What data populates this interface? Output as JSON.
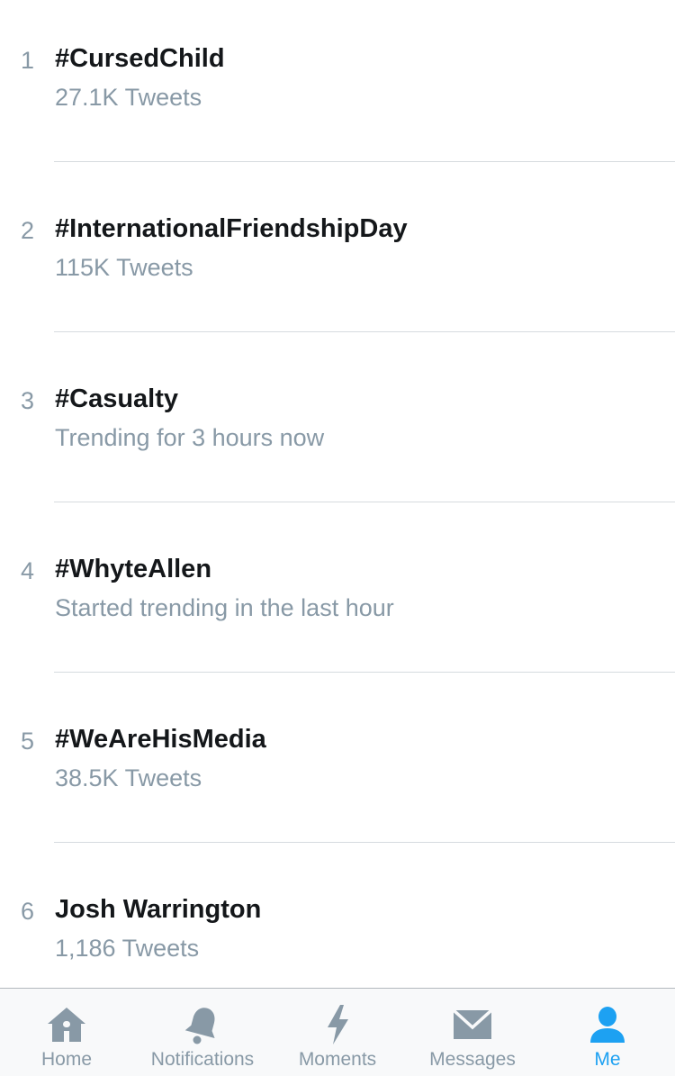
{
  "trends": [
    {
      "rank": "1",
      "name": "#CursedChild",
      "meta": "27.1K Tweets"
    },
    {
      "rank": "2",
      "name": "#InternationalFriendshipDay",
      "meta": "115K Tweets"
    },
    {
      "rank": "3",
      "name": "#Casualty",
      "meta": "Trending for 3 hours now"
    },
    {
      "rank": "4",
      "name": "#WhyteAllen",
      "meta": "Started trending in the last hour"
    },
    {
      "rank": "5",
      "name": "#WeAreHisMedia",
      "meta": "38.5K Tweets"
    },
    {
      "rank": "6",
      "name": "Josh Warrington",
      "meta": "1,186 Tweets"
    }
  ],
  "tabbar": {
    "tabs": [
      {
        "label": "Home",
        "icon": "home-icon",
        "active": false
      },
      {
        "label": "Notifications",
        "icon": "bell-icon",
        "active": false
      },
      {
        "label": "Moments",
        "icon": "lightning-icon",
        "active": false
      },
      {
        "label": "Messages",
        "icon": "envelope-icon",
        "active": false
      },
      {
        "label": "Me",
        "icon": "person-icon",
        "active": true
      }
    ]
  },
  "colors": {
    "accent": "#1da1f2",
    "inactive": "#8899a6",
    "text": "#14171a",
    "divider": "#d6dbdf"
  }
}
